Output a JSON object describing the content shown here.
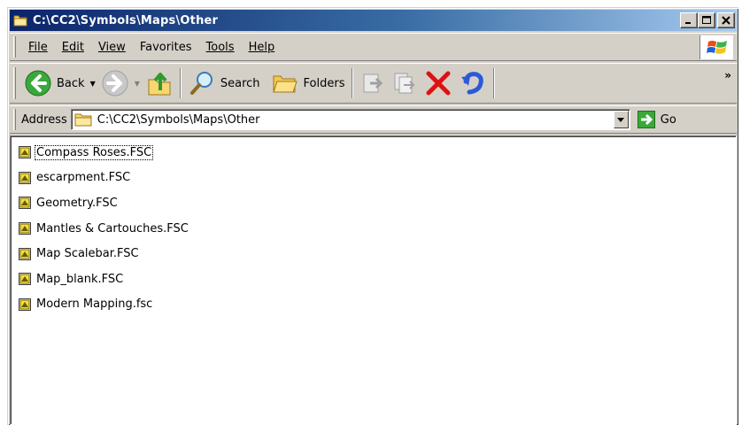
{
  "window": {
    "title": "C:\\CC2\\Symbols\\Maps\\Other"
  },
  "menubar": {
    "items": [
      {
        "label": "File",
        "icon": "",
        "underline": "F"
      },
      {
        "label": "Edit",
        "underline": "E"
      },
      {
        "label": "View",
        "underline": "V"
      },
      {
        "label": "Favorites",
        "underline": "a"
      },
      {
        "label": "Tools",
        "underline": "T"
      },
      {
        "label": "Help",
        "underline": "H"
      }
    ]
  },
  "toolbar": {
    "back_label": "Back",
    "search_label": "Search",
    "folders_label": "Folders",
    "more_glyph": "»"
  },
  "address": {
    "label": "Address",
    "value": "C:\\CC2\\Symbols\\Maps\\Other",
    "go_label": "Go"
  },
  "files": [
    {
      "name": "Compass Roses.FSC"
    },
    {
      "name": "escarpment.FSC"
    },
    {
      "name": "Geometry.FSC"
    },
    {
      "name": "Mantles & Cartouches.FSC"
    },
    {
      "name": "Map Scalebar.FSC"
    },
    {
      "name": "Map_blank.FSC"
    },
    {
      "name": "Modern Mapping.fsc"
    }
  ],
  "colors": {
    "title_start": "#0a246a",
    "title_end": "#a6caf0",
    "chrome": "#d4d0c8",
    "delete_red": "#e01010"
  }
}
